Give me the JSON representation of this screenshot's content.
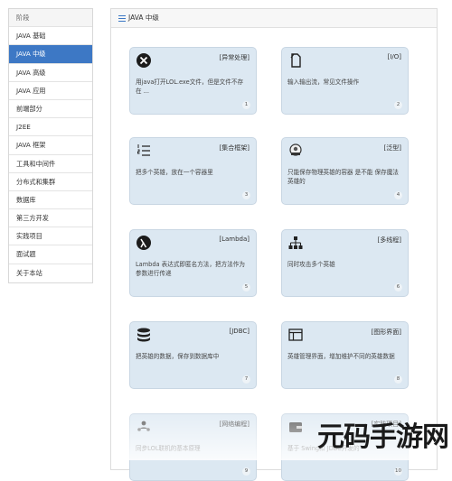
{
  "sidebar": {
    "items": [
      {
        "label": "阶段",
        "kind": "header"
      },
      {
        "label": "JAVA 基础",
        "kind": "normal"
      },
      {
        "label": "JAVA 中级",
        "kind": "active"
      },
      {
        "label": "JAVA 高级",
        "kind": "normal"
      },
      {
        "label": "JAVA 应用",
        "kind": "normal"
      },
      {
        "label": "前端部分",
        "kind": "normal"
      },
      {
        "label": "J2EE",
        "kind": "normal"
      },
      {
        "label": "JAVA 框架",
        "kind": "normal"
      },
      {
        "label": "工具和中间件",
        "kind": "normal"
      },
      {
        "label": "分布式和集群",
        "kind": "normal"
      },
      {
        "label": "数据库",
        "kind": "normal"
      },
      {
        "label": "第三方开发",
        "kind": "normal"
      },
      {
        "label": "实践项目",
        "kind": "normal"
      },
      {
        "label": "面试题",
        "kind": "normal"
      },
      {
        "label": "关于本站",
        "kind": "normal"
      }
    ]
  },
  "panel": {
    "title": "JAVA 中级",
    "cards": [
      {
        "tag": "[异常处理]",
        "desc": "用java打开LOL.exe文件，但是文件不存在 ...",
        "num": "1",
        "icon": "close-circle-icon"
      },
      {
        "tag": "[I/O]",
        "desc": "输入输出流，常见文件操作",
        "num": "2",
        "icon": "file-icon"
      },
      {
        "tag": "[集合框架]",
        "desc": "把多个英雄，放在一个容器里",
        "num": "3",
        "icon": "ordered-list-icon"
      },
      {
        "tag": "[泛型]",
        "desc": "只能保存物理英雄的容器 是不能 保存魔法英雄的",
        "num": "4",
        "icon": "globe-icon"
      },
      {
        "tag": "[Lambda]",
        "desc": "Lambda 表达式即匿名方法，把方法作为参数进行传递",
        "num": "5",
        "icon": "lambda-icon"
      },
      {
        "tag": "[多线程]",
        "desc": "同时攻击多个英雄",
        "num": "6",
        "icon": "network-icon"
      },
      {
        "tag": "[JDBC]",
        "desc": "把英雄的数据，保存到数据库中",
        "num": "7",
        "icon": "database-icon"
      },
      {
        "tag": "[图形界面]",
        "desc": "英雄管理界面，增加维护不同的英雄数据",
        "num": "8",
        "icon": "window-icon"
      },
      {
        "tag": "[网络编程]",
        "desc": "同步LOL联机的基本原理",
        "num": "9",
        "icon": "users-icon"
      },
      {
        "tag": "[实践项目]",
        "desc": "基于 Swing和 JDBC开发的",
        "num": "10",
        "icon": "wallet-icon"
      }
    ]
  },
  "watermark": "元码手游网"
}
